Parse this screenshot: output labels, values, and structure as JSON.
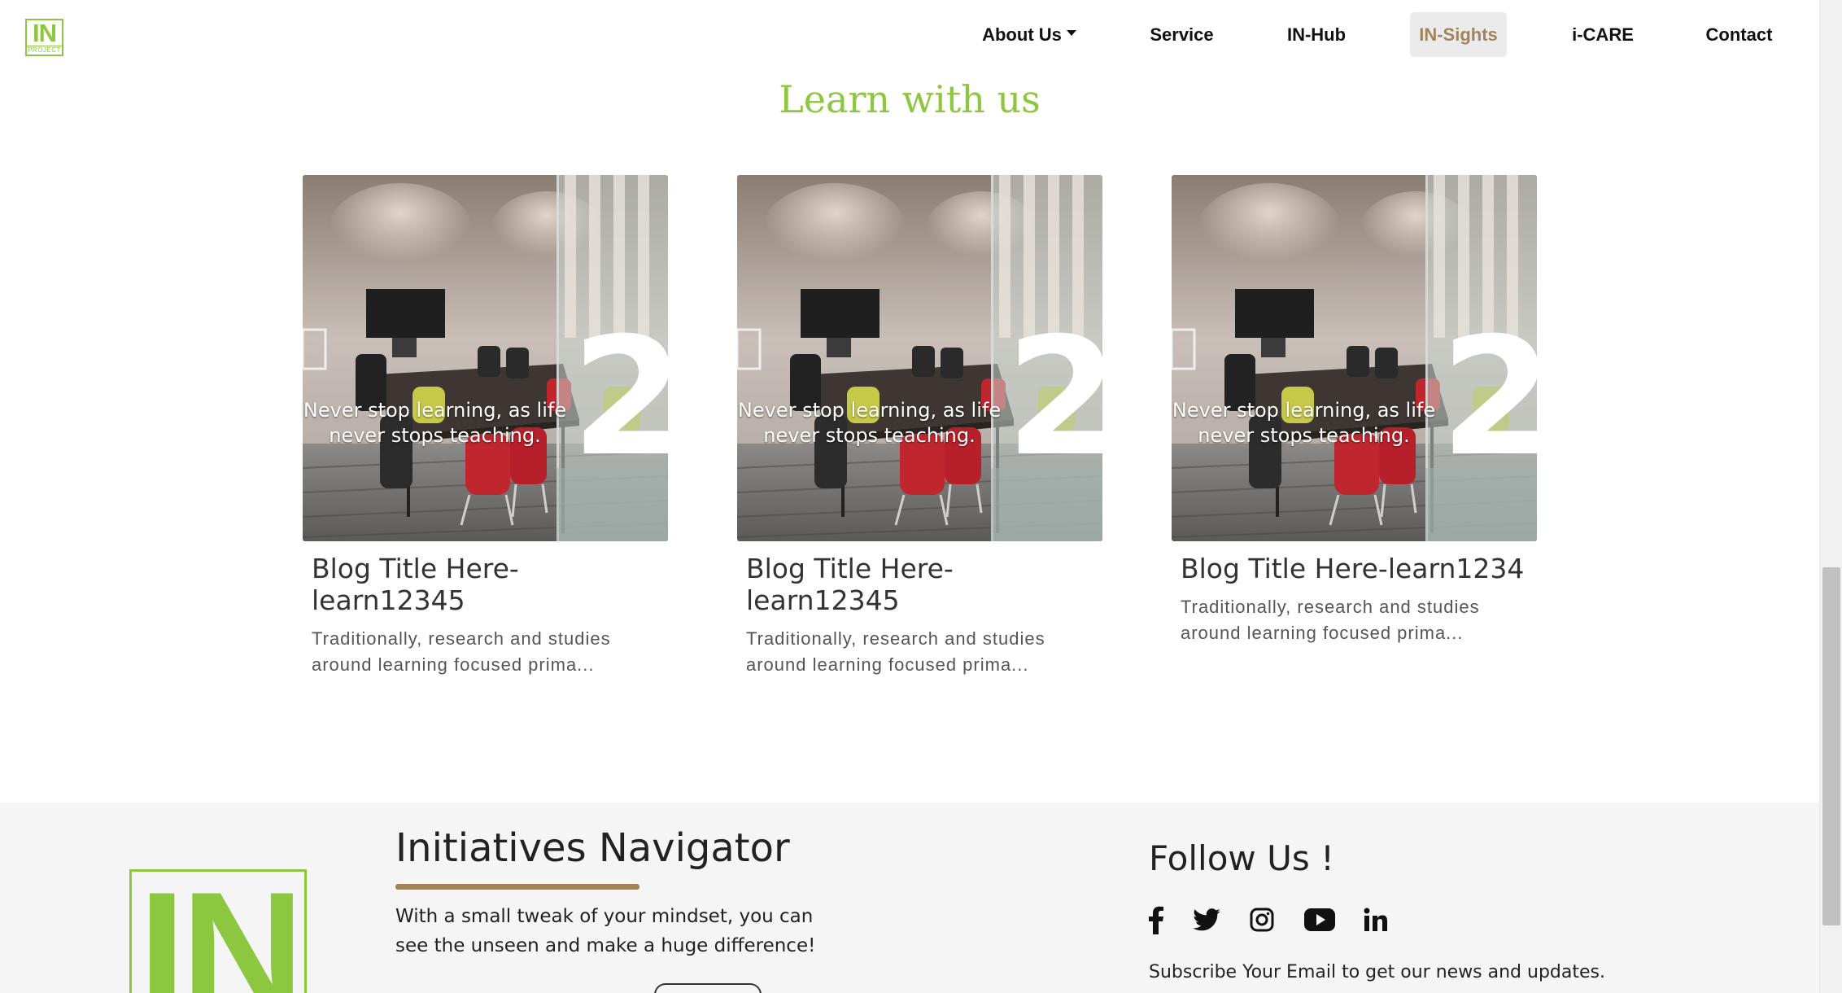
{
  "header": {
    "logo_text": "IN",
    "logo_subtext": "PROJECT",
    "nav": [
      {
        "label": "About Us",
        "has_dropdown": true
      },
      {
        "label": "Service"
      },
      {
        "label": "IN-Hub"
      },
      {
        "label": "IN-Sights",
        "active": true
      },
      {
        "label": "i-CARE"
      },
      {
        "label": "Contact"
      }
    ]
  },
  "section": {
    "title": "Learn with us"
  },
  "cards": [
    {
      "quote": "Never stop learning, as life never stops teaching.",
      "title": "Blog Title Here-learn12345",
      "description": "Traditionally, research and studies around learning focused prima..."
    },
    {
      "quote": "Never stop learning, as life never stops teaching.",
      "title": "Blog Title Here-learn12345",
      "description": "Traditionally, research and studies around learning focused prima..."
    },
    {
      "quote": "Never stop learning, as life never stops teaching.",
      "title": "Blog Title Here-learn1234",
      "description": "Traditionally, research and studies around learning focused prima..."
    }
  ],
  "footer": {
    "logo_text": "IN",
    "navigator_title": "Initiatives Navigator",
    "navigator_text": "With a small tweak of your mindset, you can see the unseen and make a huge difference!",
    "follow_title": "Follow Us !",
    "social_icons": [
      "facebook-icon",
      "twitter-icon",
      "instagram-icon",
      "youtube-icon",
      "linkedin-icon"
    ],
    "subscribe_text": "Subscribe Your Email to get our news and updates."
  },
  "colors": {
    "brand_green": "#8dc63f",
    "accent_brown": "#a0855b",
    "footer_bg": "#f5f5f5"
  }
}
